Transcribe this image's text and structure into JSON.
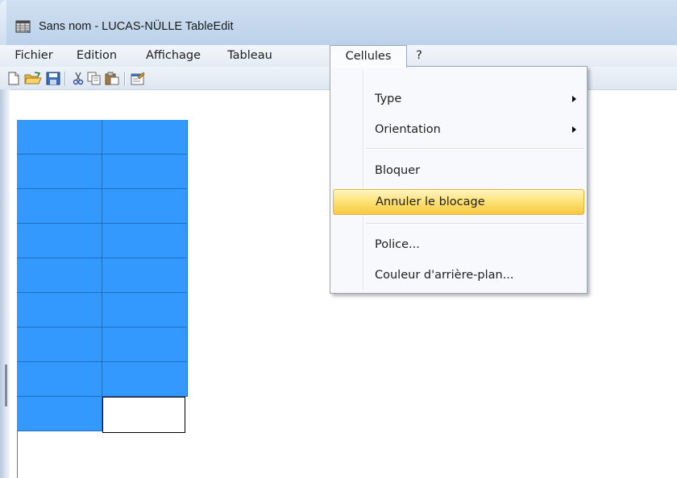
{
  "window": {
    "title": "Sans nom - LUCAS-NÜLLE TableEdit",
    "icon": "app-table-icon"
  },
  "menubar": {
    "items": [
      {
        "label": "Fichier"
      },
      {
        "label": "Edition"
      },
      {
        "label": "Affichage"
      },
      {
        "label": "Tableau"
      },
      {
        "label": "Cellules"
      },
      {
        "label": "?"
      }
    ],
    "open_item": "Cellules"
  },
  "toolbar": {
    "icons": [
      "new-icon",
      "open-folder-icon",
      "save-icon",
      "cut-icon",
      "copy-icon",
      "paste-icon",
      "properties-icon"
    ]
  },
  "dropdown": {
    "items": [
      {
        "label": "Type",
        "submenu": true
      },
      {
        "label": "Orientation",
        "submenu": true
      },
      {
        "label": "Bloquer",
        "submenu": false
      },
      {
        "label": "Annuler le blocage",
        "submenu": false,
        "highlighted": true
      },
      {
        "label": "Police...",
        "submenu": false
      },
      {
        "label": "Couleur d'arrière-plan...",
        "submenu": false
      }
    ]
  },
  "table": {
    "rows": 9,
    "cols": 2,
    "selected_color": "#3399ff",
    "unselected_cell": {
      "row": 8,
      "col": 1
    }
  },
  "colors": {
    "highlight": "#fde37a",
    "selection": "#3399ff",
    "titlebar": "#c6d9ee"
  }
}
